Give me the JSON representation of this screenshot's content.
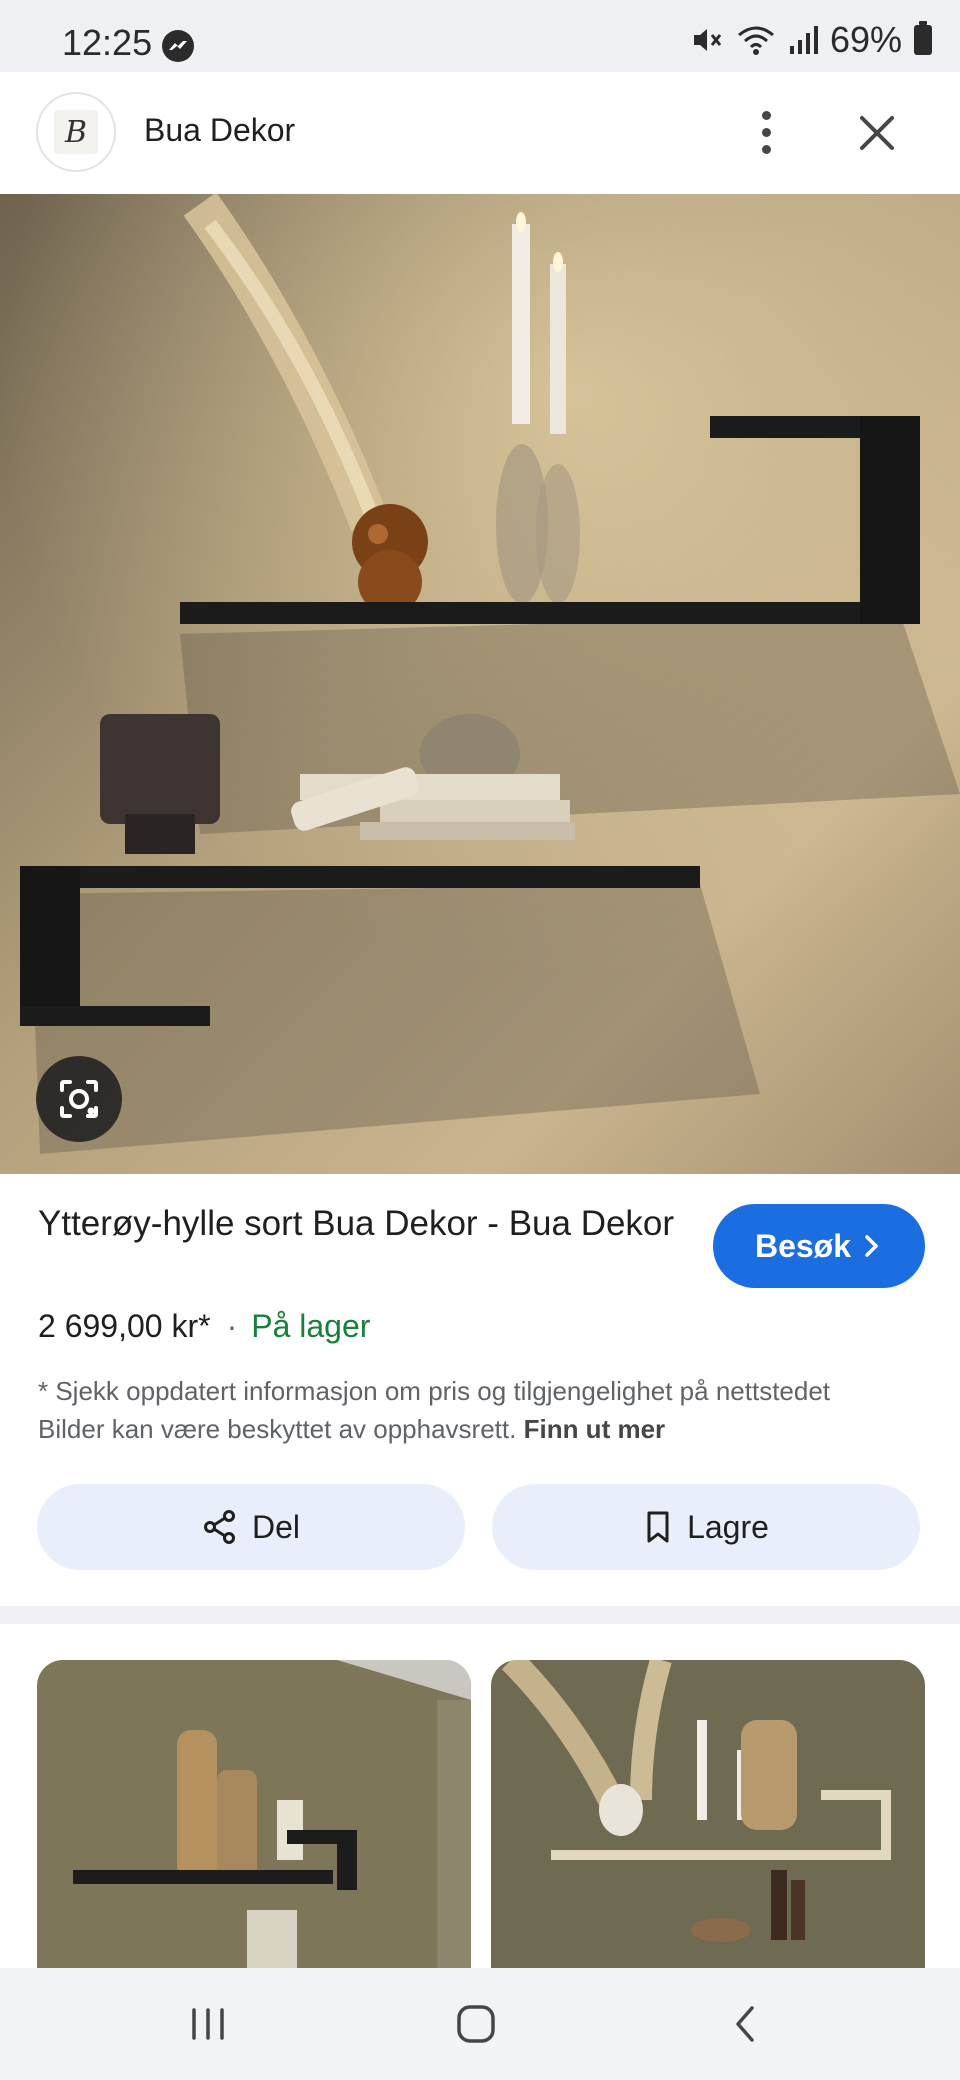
{
  "status_bar": {
    "time": "12:25",
    "battery": "69%",
    "icons": [
      "messenger-icon",
      "mute-icon",
      "wifi-icon",
      "signal-icon",
      "battery-icon"
    ]
  },
  "header": {
    "site_name": "Bua Dekor",
    "logo_letter": "B",
    "icons": [
      "more-vert-icon",
      "close-icon"
    ]
  },
  "product": {
    "title": "Ytterøy-hylle sort Bua Dekor - Bua Dekor",
    "visit_label": "Besøk",
    "price": "2 699,00 kr*",
    "separator": "·",
    "stock": "På lager",
    "disclaimer": "* Sjekk oppdatert informasjon om pris og tilgjengelighet på nettstedet Bilder kan være beskyttet av opphavsrett.",
    "learn_more": "Finn ut mer"
  },
  "actions": {
    "share_label": "Del",
    "save_label": "Lagre"
  },
  "colors": {
    "accent": "#1a6ee0",
    "stock_green": "#188038",
    "pill_bg": "#e8eefa"
  }
}
